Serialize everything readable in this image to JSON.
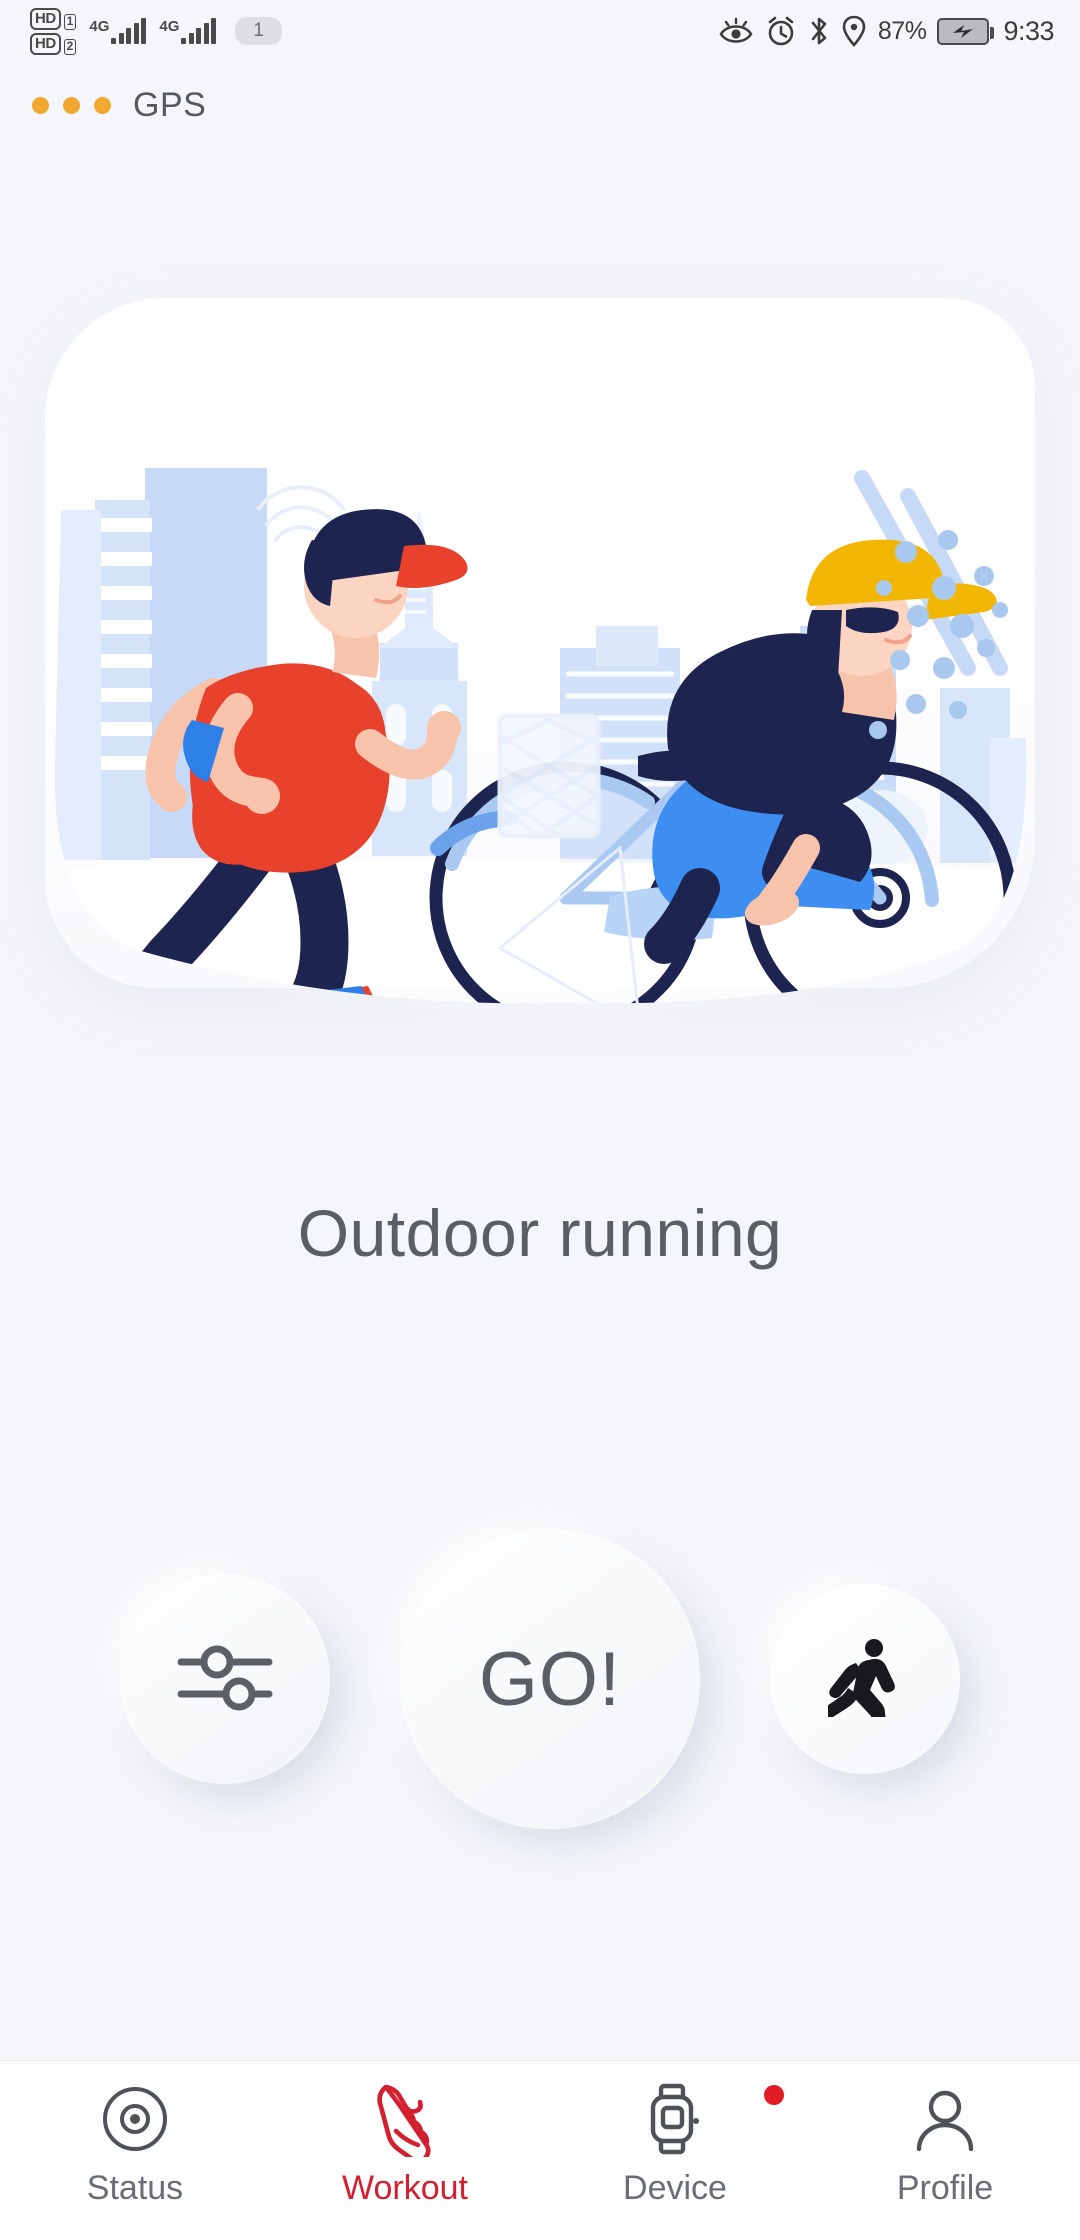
{
  "status_bar": {
    "hd_badge_1": "HD",
    "hd_badge_1_num": "1",
    "hd_badge_2": "HD",
    "hd_badge_2_num": "2",
    "network_1": "4G",
    "network_2": "4G",
    "network_2_sub": "1",
    "sim_pill": "1",
    "battery_percent": "87%",
    "time": "9:33",
    "icons": [
      "eye-comfort-icon",
      "alarm-icon",
      "bluetooth-icon",
      "location-icon",
      "battery-charging-icon"
    ]
  },
  "gps": {
    "label": "GPS",
    "dot_count": 3,
    "dot_color": "#f2a830"
  },
  "illustration": {
    "name": "runner-and-cyclist-illustration",
    "colors": {
      "shirt_red": "#e8412c",
      "pants_navy": "#1d2450",
      "cap_navy": "#1d2450",
      "cap_red": "#e8412c",
      "shoe_blue": "#2f7fe8",
      "skin": "#fcd5c2",
      "cyclist_cap_yellow": "#f2b705",
      "cyclist_jacket": "#1d2450",
      "cyclist_pants": "#3d8ef0",
      "building_blue": "#c3d8f7",
      "bike_navy": "#1d2450",
      "bike_light": "#a9c9f2",
      "dot_blue": "#a8c8ee"
    }
  },
  "main": {
    "title": "Outdoor running"
  },
  "actions": {
    "settings_label": "settings-sliders-icon",
    "go_label": "GO!",
    "mode_label": "running-person-icon"
  },
  "bottom_nav": {
    "active_color": "#d32030",
    "inactive_color": "#6a6e74",
    "items": [
      {
        "label": "Status",
        "icon": "status-target-icon",
        "active": false,
        "badge": false
      },
      {
        "label": "Workout",
        "icon": "running-shoe-icon",
        "active": true,
        "badge": false
      },
      {
        "label": "Device",
        "icon": "smartwatch-icon",
        "active": false,
        "badge": true
      },
      {
        "label": "Profile",
        "icon": "person-icon",
        "active": false,
        "badge": false
      }
    ]
  }
}
